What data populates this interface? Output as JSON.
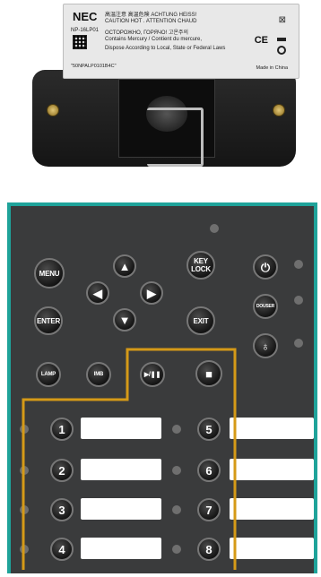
{
  "lamp_label": {
    "brand": "NEC",
    "model": "NP-16LP01",
    "line1": "高温注意  高温危険  ACHTUNG HEISS!",
    "line2": "CAUTION HOT .  ATTENTION CHAUD",
    "line3": "ОСТОРОЖНО, ГОРЯЧО!  고온주의",
    "line4": "Contains Mercury / Contient du mercure,",
    "line5": "Dispose According to Local, State or Federal Laws",
    "serial": "\"50NPALP0101B4C\"",
    "made_in": "Made in China",
    "ce": "CE"
  },
  "panel": {
    "buttons": {
      "menu": "MENU",
      "enter": "ENTER",
      "key_lock": "KEY\nLOCK",
      "exit": "EXIT",
      "douser": "DOUSER",
      "lamp": "LAMP",
      "imb": "IMB",
      "play_pause": "▶/❚❚",
      "stop": "■",
      "power": "⏻",
      "lamp_bulb": "♁",
      "up": "▲",
      "down": "▼",
      "left": "◀",
      "right": "▶"
    },
    "numbers": [
      "1",
      "2",
      "3",
      "4",
      "5",
      "6",
      "7",
      "8"
    ],
    "accent_color": "#1fa39a",
    "outline_color": "#d59a17"
  }
}
